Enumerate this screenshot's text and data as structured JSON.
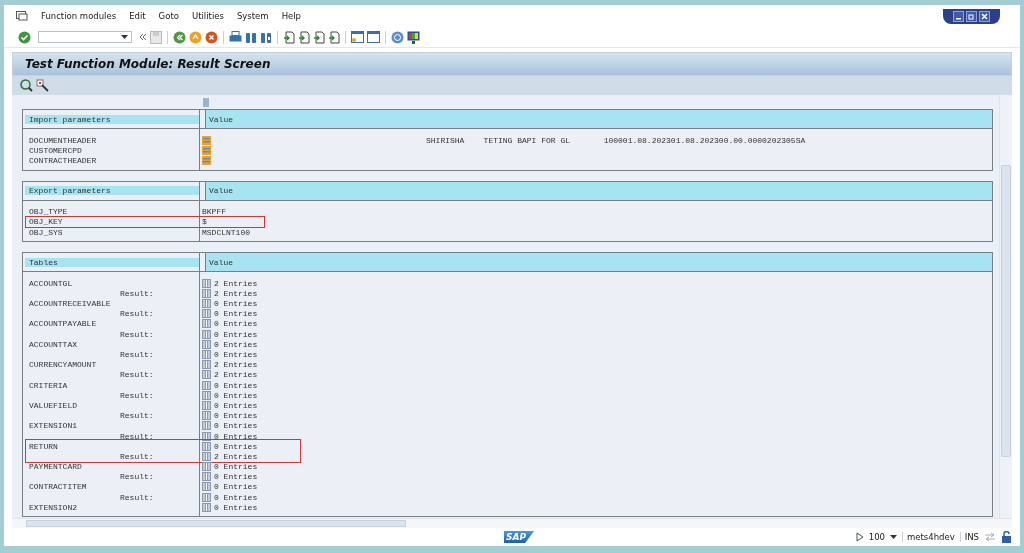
{
  "menu": [
    {
      "label": "Function modules"
    },
    {
      "label": "Edit"
    },
    {
      "label": "Goto"
    },
    {
      "label": "Utilities"
    },
    {
      "label": "System"
    },
    {
      "label": "Help"
    }
  ],
  "title": "Test Function Module: Result Screen",
  "import_section": {
    "header": "Import parameters",
    "value_header": "Value",
    "rows": [
      {
        "name": "DOCUMENTHEADER",
        "value": "SHIRISHA    TETING BAPI FOR GL       100001.08.202301.08.202300.00.0000202305SA"
      },
      {
        "name": "CUSTOMERCPD"
      },
      {
        "name": "CONTRACTHEADER"
      }
    ]
  },
  "export_section": {
    "header": "Export parameters",
    "value_header": "Value",
    "rows": [
      {
        "name": "OBJ_TYPE",
        "value": "BKPFF",
        "highlighted": false
      },
      {
        "name": "OBJ_KEY",
        "value": "$",
        "highlighted": true
      },
      {
        "name": "OBJ_SYS",
        "value": "MSDCLNT100",
        "highlighted": false
      }
    ]
  },
  "tables_section": {
    "header": "Tables",
    "value_header": "Value",
    "rows": [
      {
        "name": "ACCOUNTGL",
        "entries": "2 Entries",
        "result_label": "Result:",
        "result_entries": "2 Entries",
        "highlighted": false
      },
      {
        "name": "ACCOUNTRECEIVABLE",
        "entries": "0 Entries",
        "result_label": "Result:",
        "result_entries": "0 Entries",
        "highlighted": false
      },
      {
        "name": "ACCOUNTPAYABLE",
        "entries": "0 Entries",
        "result_label": "Result:",
        "result_entries": "0 Entries",
        "highlighted": false
      },
      {
        "name": "ACCOUNTTAX",
        "entries": "0 Entries",
        "result_label": "Result:",
        "result_entries": "0 Entries",
        "highlighted": false
      },
      {
        "name": "CURRENCYAMOUNT",
        "entries": "2 Entries",
        "result_label": "Result:",
        "result_entries": "2 Entries",
        "highlighted": false
      },
      {
        "name": "CRITERIA",
        "entries": "0 Entries",
        "result_label": "Result:",
        "result_entries": "0 Entries",
        "highlighted": false
      },
      {
        "name": "VALUEFIELD",
        "entries": "0 Entries",
        "result_label": "Result:",
        "result_entries": "0 Entries",
        "highlighted": false
      },
      {
        "name": "EXTENSION1",
        "entries": "0 Entries",
        "result_label": "Result:",
        "result_entries": "0 Entries",
        "highlighted": false
      },
      {
        "name": "RETURN",
        "entries": "0 Entries",
        "result_label": "Result:",
        "result_entries": "2 Entries",
        "highlighted": true
      },
      {
        "name": "PAYMENTCARD",
        "entries": "0 Entries",
        "result_label": "Result:",
        "result_entries": "0 Entries",
        "highlighted": false
      },
      {
        "name": "CONTRACTITEM",
        "entries": "0 Entries",
        "result_label": "Result:",
        "result_entries": "0 Entries",
        "highlighted": false
      },
      {
        "name": "EXTENSION2",
        "entries": "0 Entries",
        "highlighted": false
      }
    ]
  },
  "status_bar": {
    "logo": "SAP",
    "zoom": "100",
    "system": "mets4hdev",
    "mode": "INS"
  }
}
